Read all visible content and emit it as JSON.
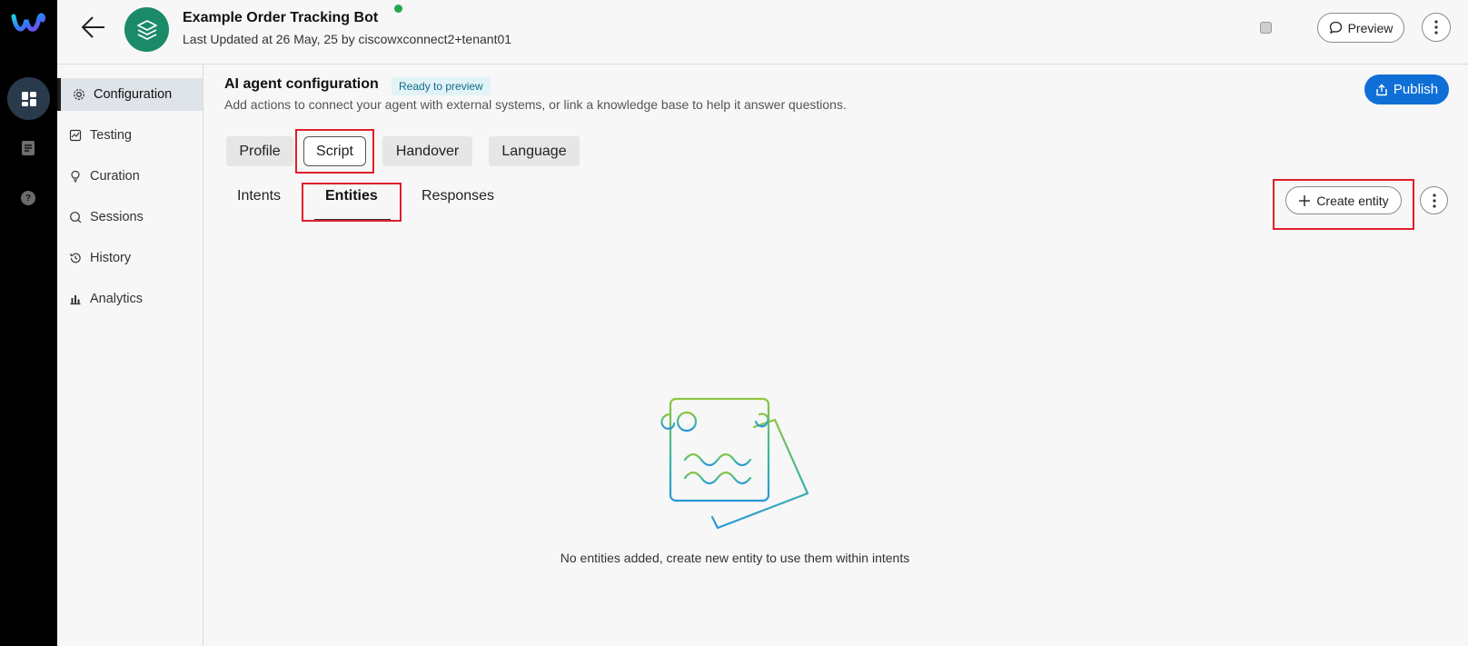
{
  "header": {
    "bot_name": "Example Order Tracking Bot",
    "last_updated": "Last Updated at 26 May, 25 by ciscowxconnect2+tenant01",
    "preview_label": "Preview",
    "status_color": "#1fa84f"
  },
  "rail": {
    "icons": [
      "webex-logo-icon",
      "dashboard-icon",
      "document-icon",
      "help-icon"
    ],
    "help_glyph": "?"
  },
  "sidebar": {
    "items": [
      {
        "label": "Configuration",
        "icon": "gear-icon",
        "active": true
      },
      {
        "label": "Testing",
        "icon": "testing-icon"
      },
      {
        "label": "Curation",
        "icon": "lightbulb-icon"
      },
      {
        "label": "Sessions",
        "icon": "sessions-icon"
      },
      {
        "label": "History",
        "icon": "history-icon"
      },
      {
        "label": "Analytics",
        "icon": "analytics-icon"
      }
    ]
  },
  "main": {
    "title": "AI agent configuration",
    "badge": "Ready to preview",
    "description": "Add actions to connect your agent with external systems, or link a knowledge base to help it answer questions.",
    "publish_label": "Publish",
    "tabs": [
      "Profile",
      "Script",
      "Handover",
      "Language"
    ],
    "selected_tab": "Script",
    "subtabs": [
      "Intents",
      "Entities",
      "Responses"
    ],
    "selected_subtab": "Entities",
    "create_label": "Create entity",
    "empty_message": "No entities added, create new entity to use them within intents"
  },
  "colors": {
    "accent": "#0f6fd6",
    "bot_avatar": "#1b8a68",
    "highlight": "#e0202a"
  }
}
